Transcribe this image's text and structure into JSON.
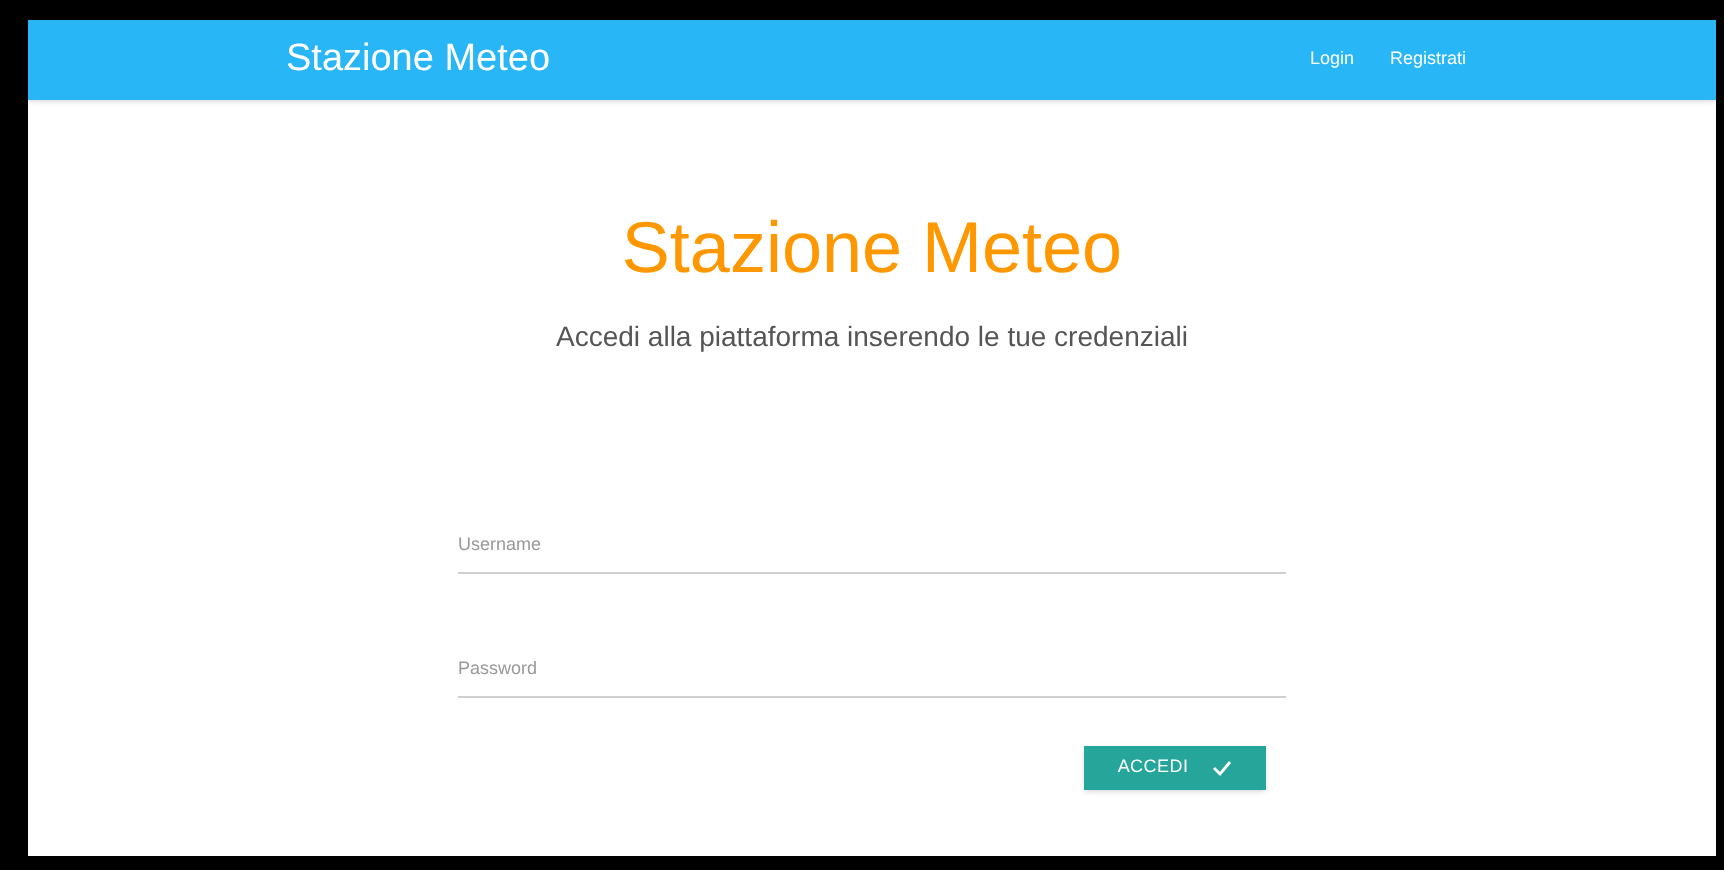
{
  "navbar": {
    "brand": "Stazione Meteo",
    "links": [
      "Login",
      "Registrati"
    ]
  },
  "heading": "Stazione Meteo",
  "subtitle": "Accedi alla piattaforma inserendo le tue credenziali",
  "form": {
    "fields": [
      {
        "placeholder": "Username"
      },
      {
        "placeholder": "Password"
      }
    ],
    "submit": {
      "label": "ACCEDI"
    }
  }
}
